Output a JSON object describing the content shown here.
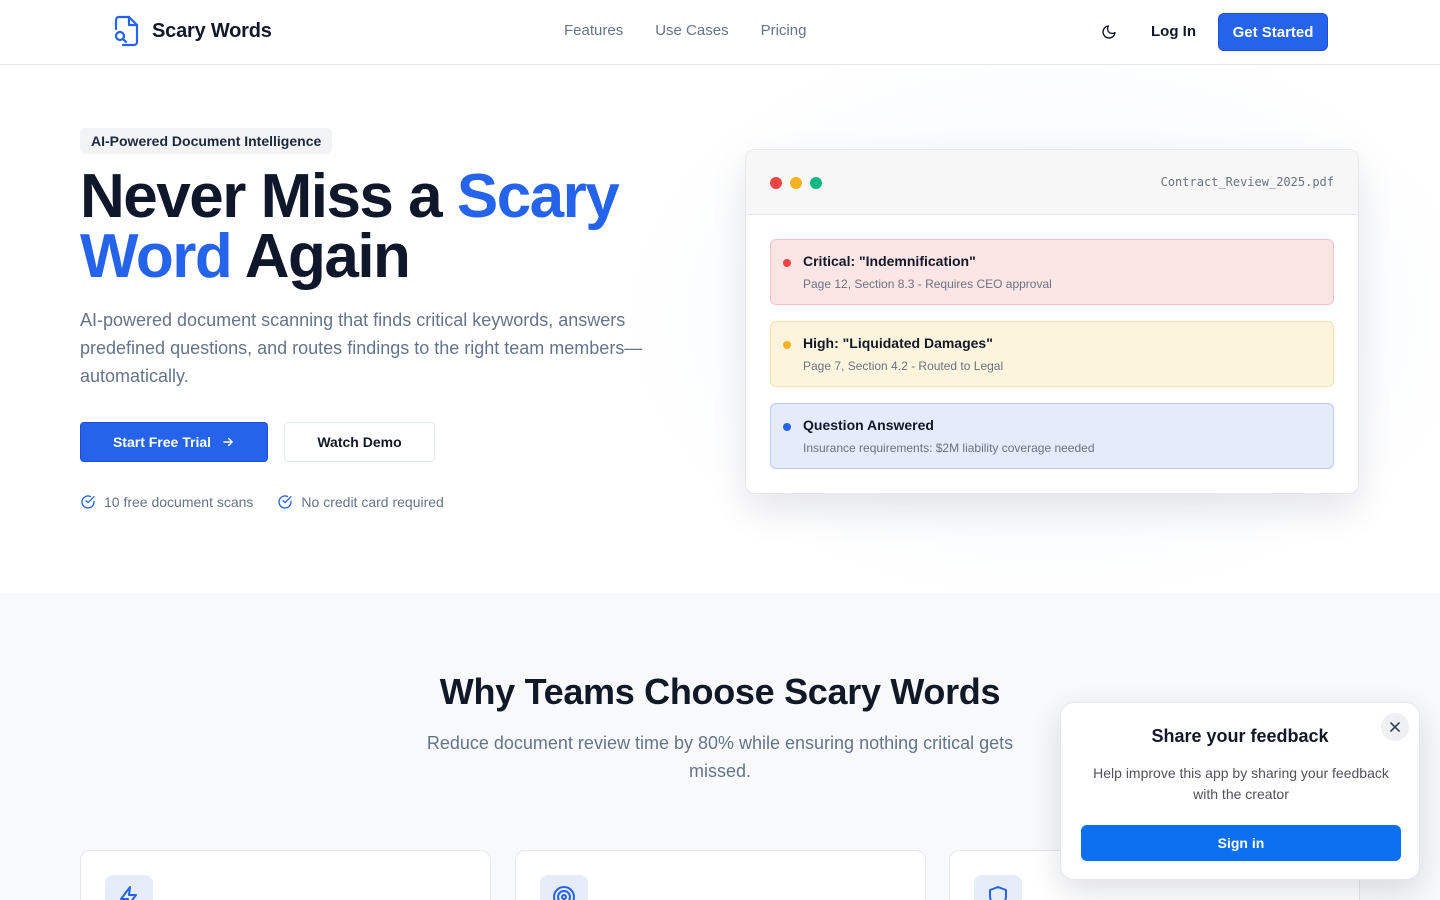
{
  "header": {
    "brand_name": "Scary Words",
    "brand_icon": "document-search-icon",
    "nav": [
      {
        "label": "Features"
      },
      {
        "label": "Use Cases"
      },
      {
        "label": "Pricing"
      }
    ],
    "theme_toggle_icon": "moon-icon",
    "login_label": "Log In",
    "cta_label": "Get Started"
  },
  "hero": {
    "badge": "AI-Powered Document Intelligence",
    "headline_part1": "Never Miss a ",
    "headline_accent": "Scary Word",
    "headline_part2": " Again",
    "subcopy": "AI-powered document scanning that finds critical keywords, answers predefined questions, and routes findings to the right team members—automatically.",
    "primary_cta": "Start Free Trial",
    "secondary_cta": "Watch Demo",
    "checks": [
      {
        "label": "10 free document scans",
        "icon": "check-circle-icon"
      },
      {
        "label": "No credit card required",
        "icon": "check-circle-icon"
      }
    ]
  },
  "preview": {
    "file_name": "Contract_Review_2025.pdf",
    "window_dots": [
      "#ef4444",
      "#f5b324",
      "#10b981"
    ],
    "findings": [
      {
        "title": "Critical: \"Indemnification\"",
        "detail": "Page 12, Section 8.3 - Requires CEO approval",
        "color": "#ef4444"
      },
      {
        "title": "High: \"Liquidated Damages\"",
        "detail": "Page 7, Section 4.2 - Routed to Legal",
        "color": "#f5b324"
      },
      {
        "title": "Question Answered",
        "detail": "Insurance requirements: $2M liability coverage needed",
        "color": "#2563eb"
      }
    ]
  },
  "why": {
    "title": "Why Teams Choose Scary Words",
    "subtitle": "Reduce document review time by 80% while ensuring nothing critical gets missed.",
    "cards": [
      {
        "icon": "lightning-icon"
      },
      {
        "icon": "target-icon"
      },
      {
        "icon": "shield-icon"
      }
    ]
  },
  "feedback": {
    "title": "Share your feedback",
    "text": "Help improve this app by sharing your feedback with the creator",
    "button": "Sign in"
  },
  "colors": {
    "accent": "#2563eb",
    "signin_blue": "#0b6ff0"
  }
}
